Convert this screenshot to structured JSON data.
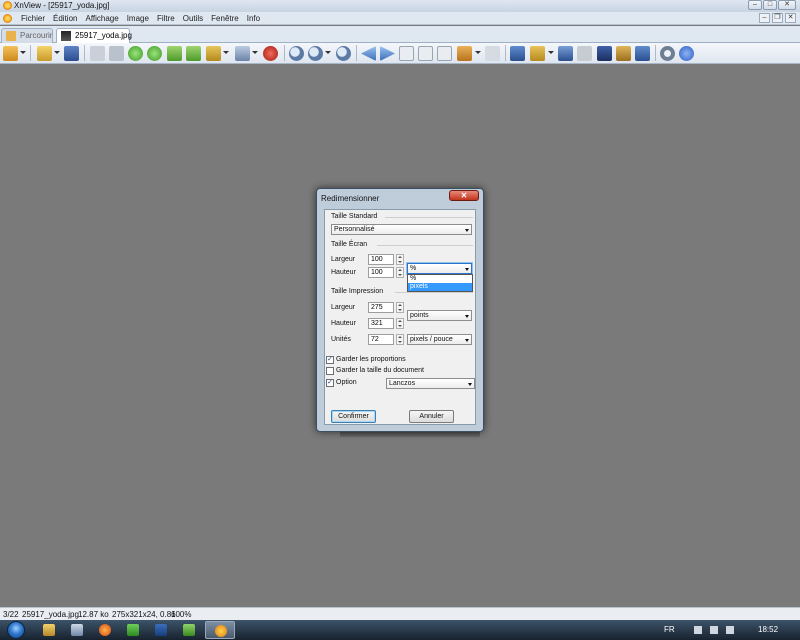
{
  "window": {
    "title": "XnView - [25917_yoda.jpg]"
  },
  "menu": [
    "Fichier",
    "Édition",
    "Affichage",
    "Image",
    "Filtre",
    "Outils",
    "Fenêtre",
    "Info"
  ],
  "tabs": [
    {
      "label": "Parcourir",
      "active": false
    },
    {
      "label": "25917_yoda.jpg",
      "active": true
    }
  ],
  "dialog": {
    "title": "Redimensionner",
    "close_glyph": "✕",
    "standard_size": {
      "label": "Taille Standard",
      "value": "Personnalisé"
    },
    "screen_size": {
      "label": "Taille Écran",
      "width_label": "Largeur",
      "width_value": "100",
      "height_label": "Hauteur",
      "height_value": "100",
      "unit_value": "%",
      "unit_options": [
        "%",
        "pixels"
      ],
      "unit_highlighted": "pixels"
    },
    "print_size": {
      "label": "Taille Impression",
      "width_label": "Largeur",
      "width_value": "275",
      "height_label": "Hauteur",
      "height_value": "321",
      "length_unit": "points",
      "resolution_label": "Unités",
      "resolution_value": "72",
      "resolution_unit": "pixels / pouce"
    },
    "keep_ratio": {
      "label": "Garder les proportions",
      "checked": true
    },
    "keep_doc_size": {
      "label": "Garder la taille du document",
      "checked": false
    },
    "option": {
      "label": "Option",
      "checked": true,
      "method": "Lanczos"
    },
    "confirm_label": "Confirmer",
    "cancel_label": "Annuler"
  },
  "status": {
    "index": "3/22",
    "filename": "25917_yoda.jpg",
    "filesize": "12.87 ko",
    "dims": "275x321x24, 0.86",
    "zoom": "100%"
  },
  "taskbar": {
    "language": "FR",
    "clock": "18:52"
  },
  "colors": {
    "workspace": "#7a7a7a",
    "selection": "#3399ff",
    "close_button": "#c2331d"
  }
}
